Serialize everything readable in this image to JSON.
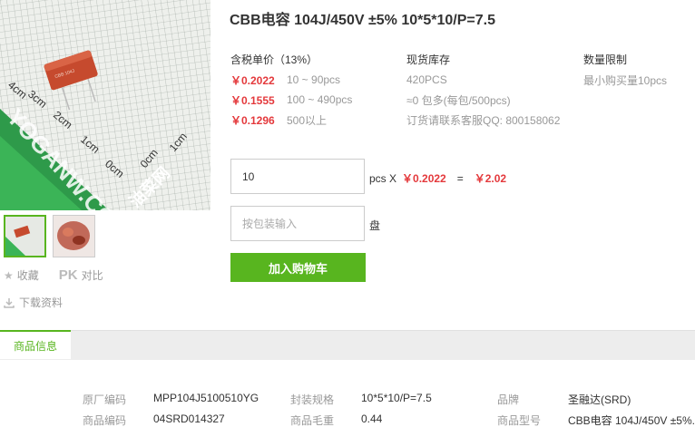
{
  "product": {
    "title": "CBB电容 104J/450V ±5% 10*5*10/P=7.5",
    "image_watermark": "YOGANW.COM",
    "image_logo": "油菜网"
  },
  "thumbnails": [
    {
      "name": "thumb-1",
      "active": true
    },
    {
      "name": "thumb-2",
      "active": false
    }
  ],
  "actions": {
    "favorite": "收藏",
    "pk_mark": "PK",
    "compare": "对比",
    "download": "下载资料"
  },
  "pricing": {
    "header": "含税单价（13%）",
    "rows": [
      {
        "price": "￥0.2022",
        "range": "10 ~ 90pcs"
      },
      {
        "price": "￥0.1555",
        "range": "100 ~ 490pcs"
      },
      {
        "price": "￥0.1296",
        "range": "500以上"
      }
    ]
  },
  "stock": {
    "header": "现货库存",
    "lines": [
      "420PCS",
      "≈0 包多(每包/500pcs)",
      "订货请联系客服QQ: 800158062"
    ]
  },
  "limit": {
    "header": "数量限制",
    "text": "最小购买量10pcs"
  },
  "order": {
    "qty_value": "10",
    "unit_x": "pcs X",
    "unit_price": "￥0.2022",
    "equals": "=",
    "total": "￥2.02",
    "pack_placeholder": "按包装输入",
    "pack_unit": "盘",
    "cart_button": "加入购物车"
  },
  "info_tab": "商品信息",
  "specs": [
    {
      "label": "原厂编码",
      "value": "MPP104J5100510YG"
    },
    {
      "label": "封装规格",
      "value": "10*5*10/P=7.5"
    },
    {
      "label": "品牌",
      "value": "圣融达(SRD)"
    },
    {
      "label": "商品编码",
      "value": "04SRD014327"
    },
    {
      "label": "商品毛重",
      "value": "0.44"
    },
    {
      "label": "商品型号",
      "value": "CBB电容 104J/450V ±5%."
    }
  ],
  "colors": {
    "accent_green": "#58b51f",
    "price_red": "#e4393c"
  }
}
